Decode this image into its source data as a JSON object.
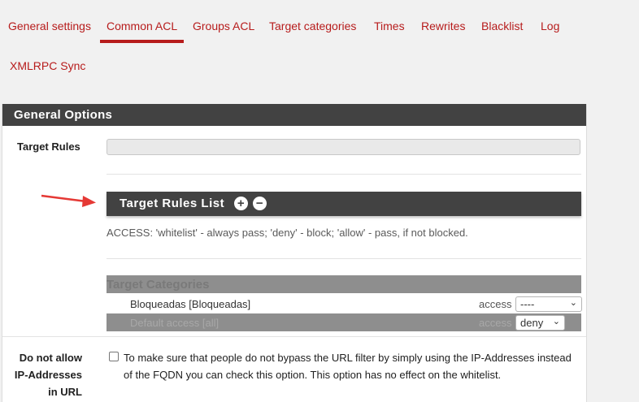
{
  "tabs": [
    {
      "label": "General settings",
      "active": false
    },
    {
      "label": "Common ACL",
      "active": true
    },
    {
      "label": "Groups ACL",
      "active": false
    },
    {
      "label": "Target categories",
      "active": false
    },
    {
      "label": "Times",
      "active": false
    },
    {
      "label": "Rewrites",
      "active": false
    },
    {
      "label": "Blacklist",
      "active": false
    },
    {
      "label": "Log",
      "active": false
    },
    {
      "label": "XMLRPC Sync",
      "active": false
    }
  ],
  "panel": {
    "title": "General Options",
    "target_rules_label": "Target Rules",
    "target_rules_value": "",
    "target_rules_list_title": "Target Rules List",
    "add_icon": "plus-circle-icon",
    "remove_icon": "minus-circle-icon",
    "help_text": "ACCESS: 'whitelist' - always pass; 'deny' - block; 'allow' - pass, if not blocked.",
    "categories_header": "Target Categories",
    "categories": [
      {
        "name": "Bloqueadas [Bloqueadas]",
        "access_label": "access",
        "value": "----"
      },
      {
        "name": "Default access [all]",
        "access_label": "access",
        "value": "deny"
      }
    ],
    "ip_label_line1": "Do not allow",
    "ip_label_line2": "IP-Addresses",
    "ip_label_line3": "in URL",
    "ip_checked": false,
    "ip_help": "To make sure that people do not bypass the URL filter by simply using the IP-Addresses instead of the FQDN you can check this option. This option has no effect on the whitelist."
  },
  "colors": {
    "accent": "#b71c1c",
    "heading_bg": "#424242",
    "category_bg": "#8e8e8e",
    "annotation_arrow": "#e53935"
  }
}
